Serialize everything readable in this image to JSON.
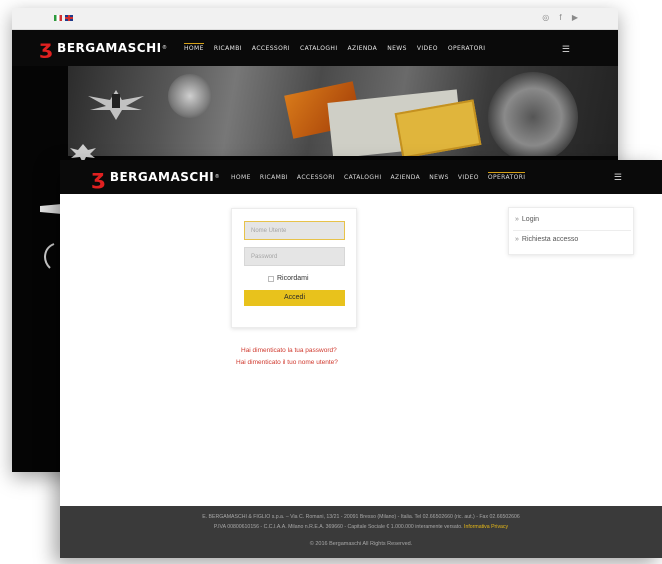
{
  "brand": {
    "name": "BERGAMASCHI",
    "mark": "ʒ",
    "reg": "®"
  },
  "colors": {
    "accent": "#e8c21c",
    "brand_red": "#e02020",
    "link_red": "#d03a2f",
    "footer_bg": "#3a3a3a"
  },
  "back_window": {
    "social": "◎ f ▶",
    "menu": [
      {
        "label": "HOME",
        "active": true
      },
      {
        "label": "RICAMBI"
      },
      {
        "label": "ACCESSORI"
      },
      {
        "label": "CATALOGHI"
      },
      {
        "label": "AZIENDA"
      },
      {
        "label": "NEWS"
      },
      {
        "label": "VIDEO"
      },
      {
        "label": "OPERATORI"
      }
    ],
    "menu_icon": "☰"
  },
  "front_window": {
    "menu": [
      {
        "label": "HOME"
      },
      {
        "label": "RICAMBI"
      },
      {
        "label": "ACCESSORI"
      },
      {
        "label": "CATALOGHI"
      },
      {
        "label": "AZIENDA"
      },
      {
        "label": "NEWS"
      },
      {
        "label": "VIDEO"
      },
      {
        "label": "OPERATORI",
        "active": true
      }
    ],
    "menu_icon": "☰",
    "login": {
      "username_placeholder": "Nome Utente",
      "password_placeholder": "Password",
      "remember_label": "Ricordami",
      "submit_label": "Accedi"
    },
    "forgot_password": "Hai dimenticato la tua password?",
    "forgot_username": "Hai dimenticato il tuo nome utente?",
    "side_menu": [
      {
        "arrow": "»",
        "label": "Login"
      },
      {
        "arrow": "»",
        "label": "Richiesta accesso"
      }
    ],
    "footer": {
      "line1": "E. BERGAMASCHI & FIGLIO s.p.a. – Via C. Romani, 13/21 - 20091 Bresso (Milano) - Italia. Tel 02.66502660 (ric. aut.) - Fax 02.66502606",
      "line2": "P.IVA 00800610156 - C.C.I.A.A. Milano n.R.E.A. 369660 - Capitale Sociale € 1.000.000 interamente versato.",
      "privacy_link": "Informativa Privacy",
      "copyright": "© 2016 Bergamaschi All Rights Reserved."
    }
  }
}
